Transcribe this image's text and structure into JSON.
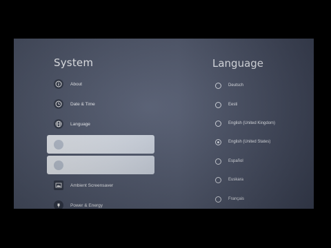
{
  "system": {
    "title": "System",
    "items": [
      {
        "label": "About",
        "icon": "info-icon"
      },
      {
        "label": "Date & Time",
        "icon": "clock-icon"
      },
      {
        "label": "Language",
        "icon": "globe-icon"
      },
      {
        "label": "",
        "icon": "keyboard-icon"
      },
      {
        "label": "",
        "icon": "storage-icon"
      },
      {
        "label": "Ambient Screensaver",
        "icon": "screensaver-icon"
      },
      {
        "label": "Power & Energy",
        "icon": "power-icon"
      }
    ]
  },
  "language": {
    "title": "Language",
    "options": [
      {
        "label": "Deutsch",
        "selected": false
      },
      {
        "label": "Eesti",
        "selected": false
      },
      {
        "label": "English (United Kingdom)",
        "selected": false
      },
      {
        "label": "English (United States)",
        "selected": true
      },
      {
        "label": "Español",
        "selected": false
      },
      {
        "label": "Euskara",
        "selected": false
      },
      {
        "label": "Français",
        "selected": false
      }
    ]
  }
}
